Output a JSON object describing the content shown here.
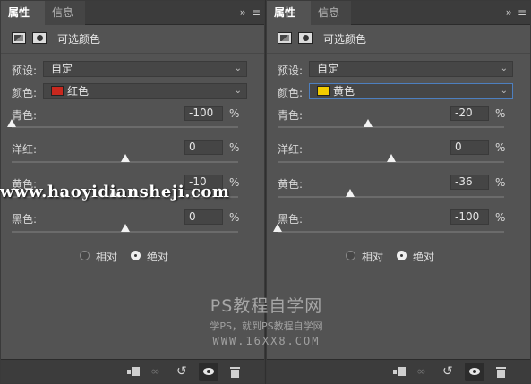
{
  "panels": [
    {
      "tabs": [
        "属性",
        "信息"
      ],
      "collapse_glyph": "»",
      "menu_glyph": "≡",
      "title": "可选颜色",
      "preset_label": "预设:",
      "preset_value": "自定",
      "color_label": "颜色:",
      "color_value": "红色",
      "swatch_color": "#c8281e",
      "sliders": [
        {
          "label": "青色:",
          "value": "-100",
          "level": -100
        },
        {
          "label": "洋红:",
          "value": "0",
          "level": 0
        },
        {
          "label": "黄色:",
          "value": "-10",
          "level": -10
        },
        {
          "label": "黑色:",
          "value": "0",
          "level": 0
        }
      ],
      "percent": "%",
      "radio_relative": "相对",
      "radio_absolute": "绝对",
      "selected_mode": "absolute"
    },
    {
      "tabs": [
        "属性",
        "信息"
      ],
      "collapse_glyph": "»",
      "menu_glyph": "≡",
      "title": "可选颜色",
      "preset_label": "预设:",
      "preset_value": "自定",
      "color_label": "颜色:",
      "color_value": "黄色",
      "swatch_color": "#f2cc00",
      "sliders": [
        {
          "label": "青色:",
          "value": "-20",
          "level": -20
        },
        {
          "label": "洋红:",
          "value": "0",
          "level": 0
        },
        {
          "label": "黄色:",
          "value": "-36",
          "level": -36
        },
        {
          "label": "黑色:",
          "value": "-100",
          "level": -100
        }
      ],
      "percent": "%",
      "radio_relative": "相对",
      "radio_absolute": "绝对",
      "selected_mode": "absolute"
    }
  ],
  "watermark": {
    "site": "www.haoyidiansheji.com",
    "title": "PS教程自学网",
    "subtitle": "学PS，就到PS教程自学网",
    "url": "WWW.16XX8.COM"
  }
}
